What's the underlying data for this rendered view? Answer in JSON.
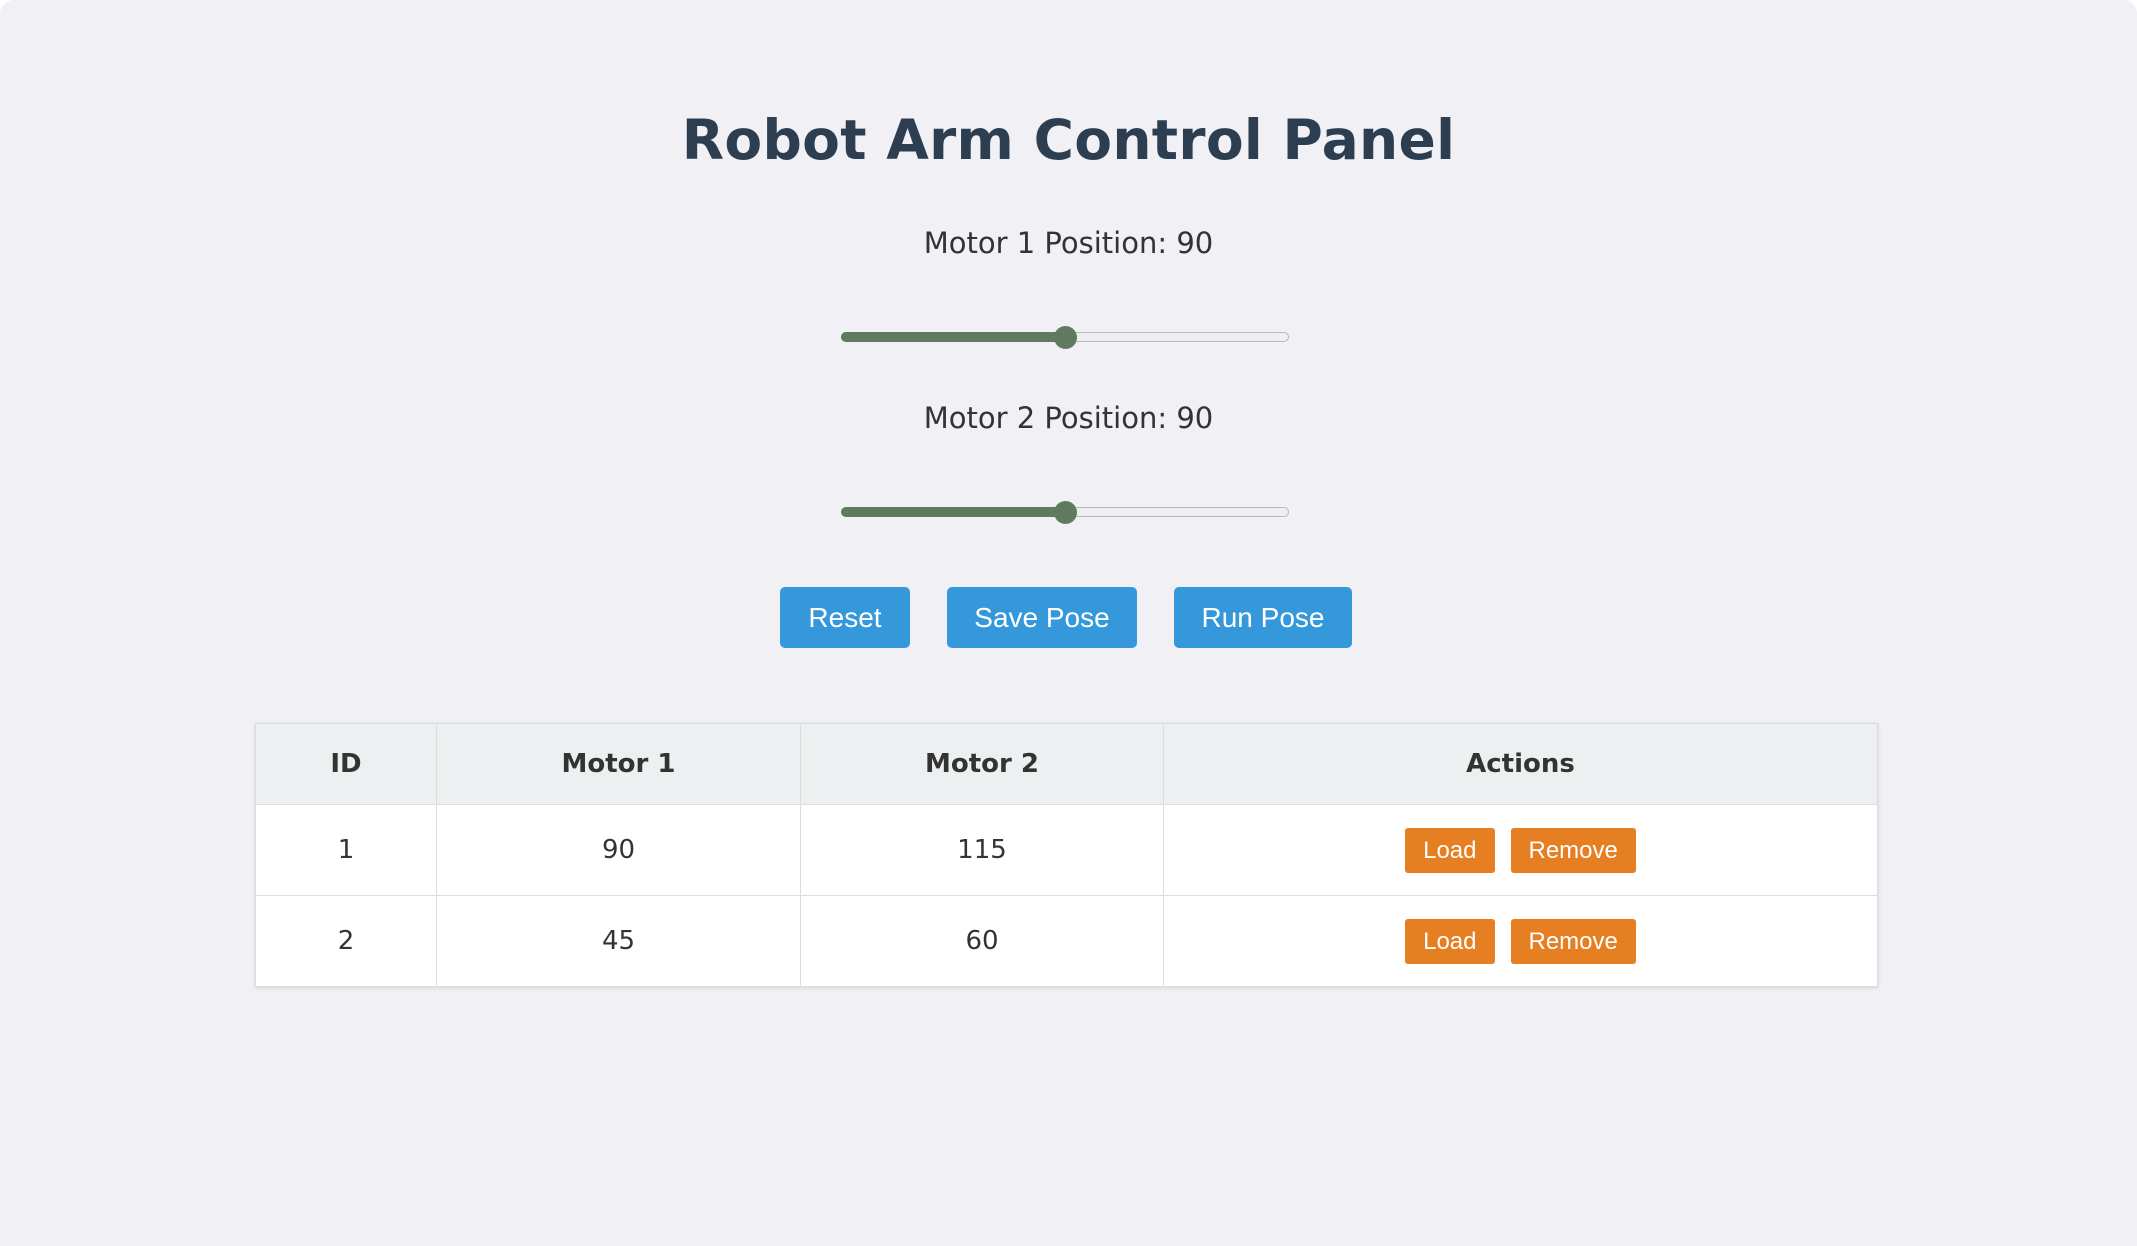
{
  "page": {
    "title": "Robot Arm Control Panel"
  },
  "motors": [
    {
      "label": "Motor 1 Position: 90",
      "value": 90,
      "min": 0,
      "max": 180
    },
    {
      "label": "Motor 2 Position: 90",
      "value": 90,
      "min": 0,
      "max": 180
    }
  ],
  "controls": {
    "reset_label": "Reset",
    "save_label": "Save Pose",
    "run_label": "Run Pose"
  },
  "table": {
    "headers": [
      "ID",
      "Motor 1",
      "Motor 2",
      "Actions"
    ],
    "rows": [
      {
        "id": "1",
        "motor1": "90",
        "motor2": "115",
        "load_label": "Load",
        "remove_label": "Remove"
      },
      {
        "id": "2",
        "motor1": "45",
        "motor2": "60",
        "load_label": "Load",
        "remove_label": "Remove"
      }
    ]
  },
  "colors": {
    "background": "#f0f0f5",
    "title": "#2c3e50",
    "primary_button": "#3498db",
    "action_button": "#e67e22",
    "slider_fill": "#5f7a5f",
    "table_header": "#ecf0f1"
  }
}
